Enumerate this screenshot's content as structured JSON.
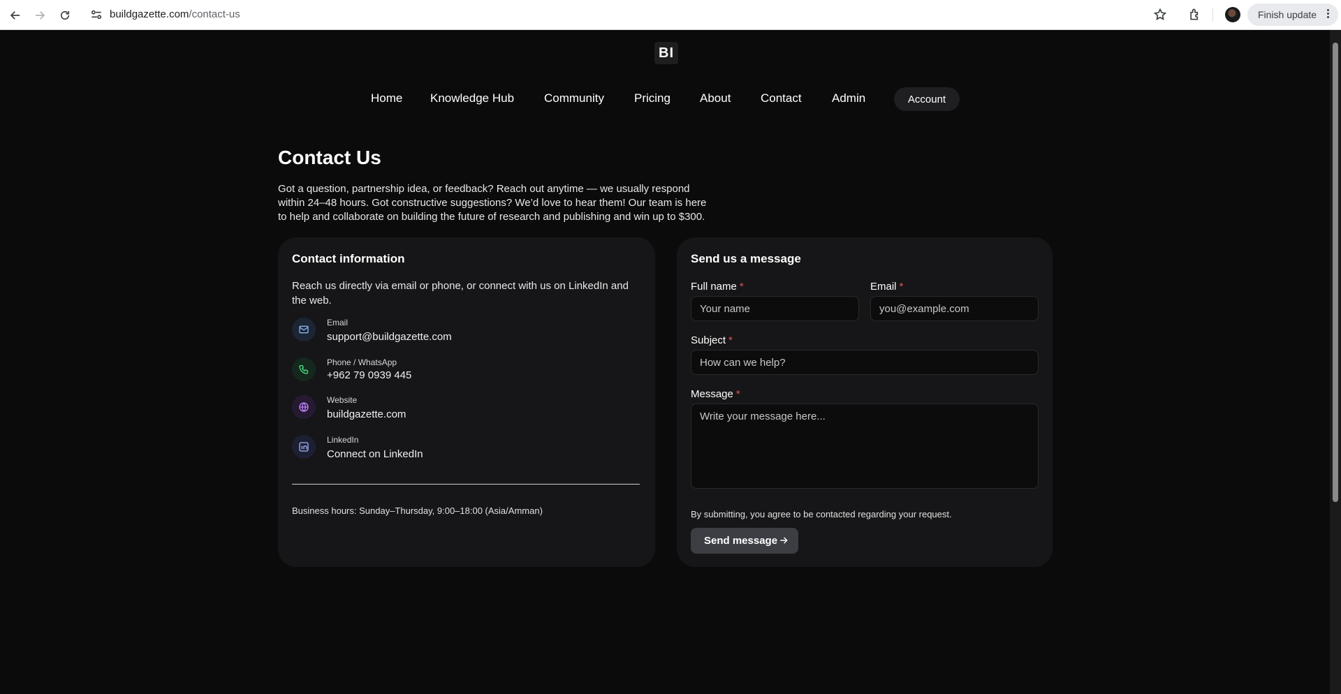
{
  "browser": {
    "url_domain": "buildgazette.com",
    "url_path": "/contact-us",
    "finish_update_label": "Finish update"
  },
  "site": {
    "logo_text": "BI",
    "nav": {
      "home": "Home",
      "knowledge_hub": "Knowledge Hub",
      "community": "Community",
      "pricing": "Pricing",
      "about": "About",
      "contact": "Contact",
      "admin": "Admin",
      "account": "Account"
    }
  },
  "page": {
    "title": "Contact Us",
    "intro": "Got a question, partnership idea, or feedback? Reach out anytime — we usually respond within 24–48 hours. Got constructive suggestions? We’d love to hear them! Our team is here to help and collaborate on building the future of research and publishing and win up to $300."
  },
  "contact_info": {
    "heading": "Contact information",
    "description": "Reach us directly via email or phone, or connect with us on LinkedIn and the web.",
    "items": [
      {
        "label": "Email",
        "value": "support@buildgazette.com",
        "icon": "mail-icon",
        "color": "#8ab4f8",
        "bg": "#1c2533"
      },
      {
        "label": "Phone / WhatsApp",
        "value": "+962 79 0939 445",
        "icon": "phone-icon",
        "color": "#4ade80",
        "bg": "#15281e"
      },
      {
        "label": "Website",
        "value": "buildgazette.com",
        "icon": "globe-icon",
        "color": "#c084fc",
        "bg": "#261a33"
      },
      {
        "label": "LinkedIn",
        "value": "Connect on LinkedIn",
        "icon": "linkedin-icon",
        "color": "#a5b4fc",
        "bg": "#1d1f33"
      }
    ],
    "business_hours": "Business hours: Sunday–Thursday, 9:00–18:00 (Asia/Amman)"
  },
  "form": {
    "heading": "Send us a message",
    "full_name_label": "Full name",
    "full_name_placeholder": "Your name",
    "email_label": "Email",
    "email_placeholder": "you@example.com",
    "subject_label": "Subject",
    "subject_placeholder": "How can we help?",
    "message_label": "Message",
    "message_placeholder": "Write your message here...",
    "required_mark": "*",
    "consent": "By submitting, you agree to be contacted regarding your request.",
    "submit_label": "Send message"
  }
}
